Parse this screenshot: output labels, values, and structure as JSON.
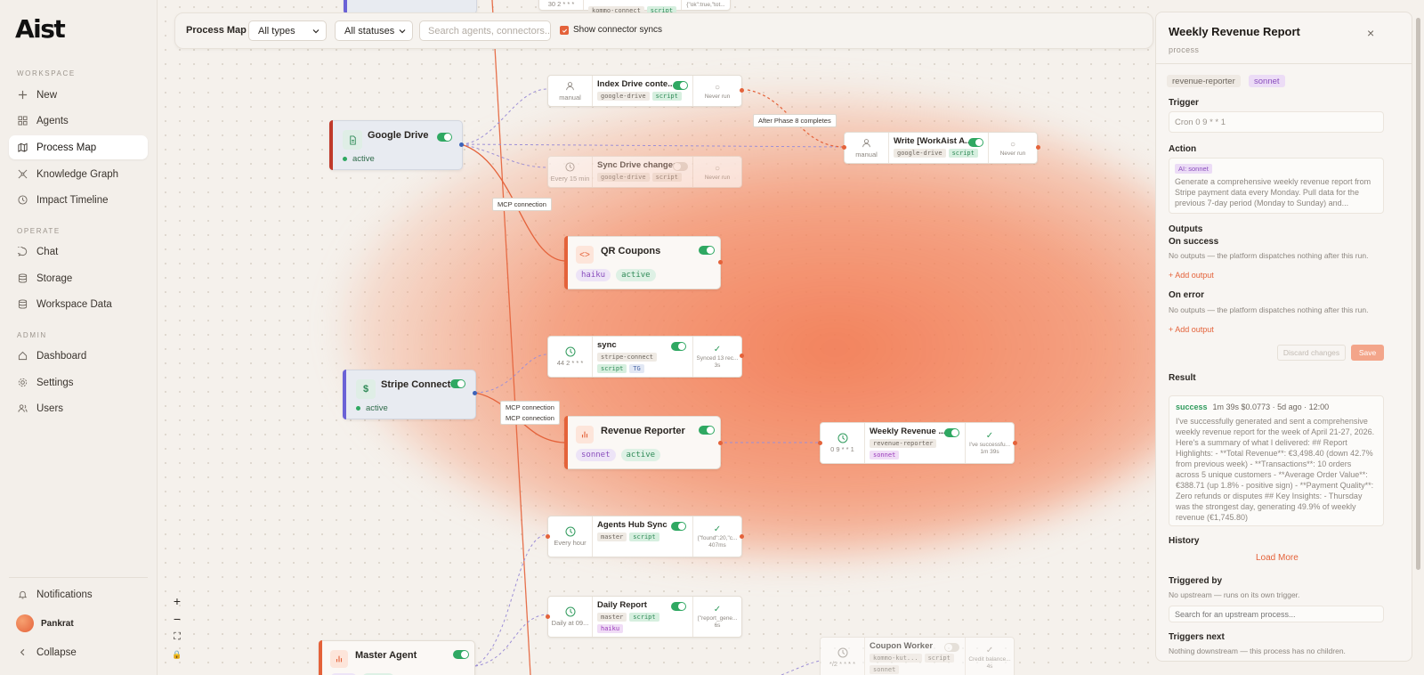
{
  "app": {
    "logo": "Aist"
  },
  "sidebar": {
    "workspace_label": "WORKSPACE",
    "operate_label": "OPERATE",
    "admin_label": "ADMIN",
    "workspace_items": [
      {
        "label": "New",
        "icon": "plus-icon"
      },
      {
        "label": "Agents",
        "icon": "grid-icon"
      },
      {
        "label": "Process Map",
        "icon": "map-icon"
      },
      {
        "label": "Knowledge Graph",
        "icon": "graph-icon"
      },
      {
        "label": "Impact Timeline",
        "icon": "clock-icon"
      }
    ],
    "operate_items": [
      {
        "label": "Chat",
        "icon": "chat-icon"
      },
      {
        "label": "Storage",
        "icon": "database-icon"
      },
      {
        "label": "Workspace Data",
        "icon": "database-icon"
      }
    ],
    "admin_items": [
      {
        "label": "Dashboard",
        "icon": "home-icon"
      },
      {
        "label": "Settings",
        "icon": "gear-icon"
      },
      {
        "label": "Users",
        "icon": "users-icon"
      }
    ],
    "notifications": "Notifications",
    "user": "Pankrat",
    "collapse": "Collapse"
  },
  "toolbar": {
    "title": "Process Map",
    "type_filter": "All types",
    "status_filter": "All statuses",
    "search_placeholder": "Search agents, connectors...",
    "show_syncs": "Show connector syncs"
  },
  "map": {
    "sources": [
      {
        "title": "Google Drive",
        "status": "active"
      },
      {
        "title": "Stripe Connect",
        "status": "active",
        "glyph": "$"
      }
    ],
    "agents": [
      {
        "title": "QR Coupons",
        "tags": [
          "haiku",
          "active"
        ],
        "glyph": "<>"
      },
      {
        "title": "Revenue Reporter",
        "tags": [
          "sonnet",
          "active"
        ]
      },
      {
        "title": "Master Agent"
      }
    ],
    "processes": {
      "top_partial": {
        "left": "30 2 * * *",
        "tags": [
          "kommo-connect",
          "script"
        ],
        "right": "{\"ok\":true,\"tot..."
      },
      "index_drive": {
        "title": "Index Drive conte...",
        "left": "manual",
        "tags": [
          "google-drive",
          "script"
        ],
        "right": "Never run"
      },
      "sync_drive": {
        "title": "Sync Drive changes",
        "left": "Every 15 min",
        "tags": [
          "google-drive",
          "script"
        ],
        "right": "Never run"
      },
      "write_workaist": {
        "title": "Write [WorkAist A...",
        "left": "manual",
        "tags": [
          "google-drive",
          "script"
        ],
        "right": "Never run"
      },
      "sync": {
        "title": "sync",
        "left": "44 2 * * *",
        "tags": [
          "stripe-connect",
          "script",
          "TG"
        ],
        "right": "Synced 13 rec...",
        "dur": "3s"
      },
      "weekly": {
        "title": "Weekly Revenue ...",
        "left": "0 9 * * 1",
        "tags": [
          "revenue-reporter",
          "sonnet"
        ],
        "right": "I've successfu...",
        "dur": "1m 39s"
      },
      "agents_hub": {
        "title": "Agents Hub Sync",
        "left": "Every hour",
        "tags": [
          "master",
          "script"
        ],
        "right": "{\"found\":20,\"c...",
        "dur": "407ms"
      },
      "daily_report": {
        "title": "Daily Report",
        "left": "Daily at 09...",
        "tags": [
          "master",
          "script",
          "haiku"
        ],
        "right": "{\"report_gene...",
        "dur": "6s"
      },
      "coupon_worker": {
        "title": "Coupon Worker",
        "left": "*/2 * * * *",
        "tags": [
          "kommo-kut...",
          "script",
          "sonnet"
        ],
        "right": "Credit balance...",
        "dur": "4s"
      }
    },
    "edge_labels": {
      "after_phase": "After Phase 8 completes",
      "mcp1": "MCP connection",
      "mcp2": "MCP connection",
      "mcp3": "MCP connection"
    },
    "check_mark": "✓",
    "circle_mark": "○"
  },
  "zoom": {
    "in": "+",
    "out": "−",
    "fit": "⛶",
    "lock": "🔒"
  },
  "panel": {
    "title": "Weekly Revenue Report",
    "subtitle": "process",
    "chips": [
      "revenue-reporter",
      "sonnet"
    ],
    "trigger_label": "Trigger",
    "trigger_value": "Cron 0 9 * * 1",
    "action_label": "Action",
    "action_badge": "AI: sonnet",
    "action_text": "Generate a comprehensive weekly revenue report from Stripe payment data every Monday. Pull data for the previous 7-day period (Monday to Sunday) and...",
    "outputs_label": "Outputs",
    "on_success_label": "On success",
    "on_success_text": "No outputs — the platform dispatches nothing after this run.",
    "add_output": "+ Add output",
    "on_error_label": "On error",
    "on_error_text": "No outputs — the platform dispatches nothing after this run.",
    "discard": "Discard changes",
    "save": "Save",
    "result_label": "Result",
    "result_status": "success",
    "result_meta": "1m 39s  $0.0773  · 5d ago · 12:00",
    "result_text": "I've successfully generated and sent a comprehensive weekly revenue report for the week of April 21-27, 2026. Here's a summary of what I delivered: ## Report Highlights: - **Total Revenue**: €3,498.40 (down 42.7% from previous week) - **Transactions**: 10 orders across 5 unique customers - **Average Order Value**: €388.71 (up 1.8% - positive sign) - **Payment Quality**: Zero refunds or disputes ## Key Insights: - Thursday was the strongest day, generating 49.9% of weekly revenue (€1,745.80)",
    "history_label": "History",
    "load_more": "Load More",
    "triggered_by_label": "Triggered by",
    "triggered_by_text": "No upstream — runs on its own trigger.",
    "upstream_placeholder": "Search for an upstream process...",
    "triggers_next_label": "Triggers next",
    "triggers_next_text": "Nothing downstream — this process has no children."
  },
  "colors": {
    "accent": "#e4623a",
    "success": "#2fa862",
    "purple": "#8a4fbd"
  }
}
